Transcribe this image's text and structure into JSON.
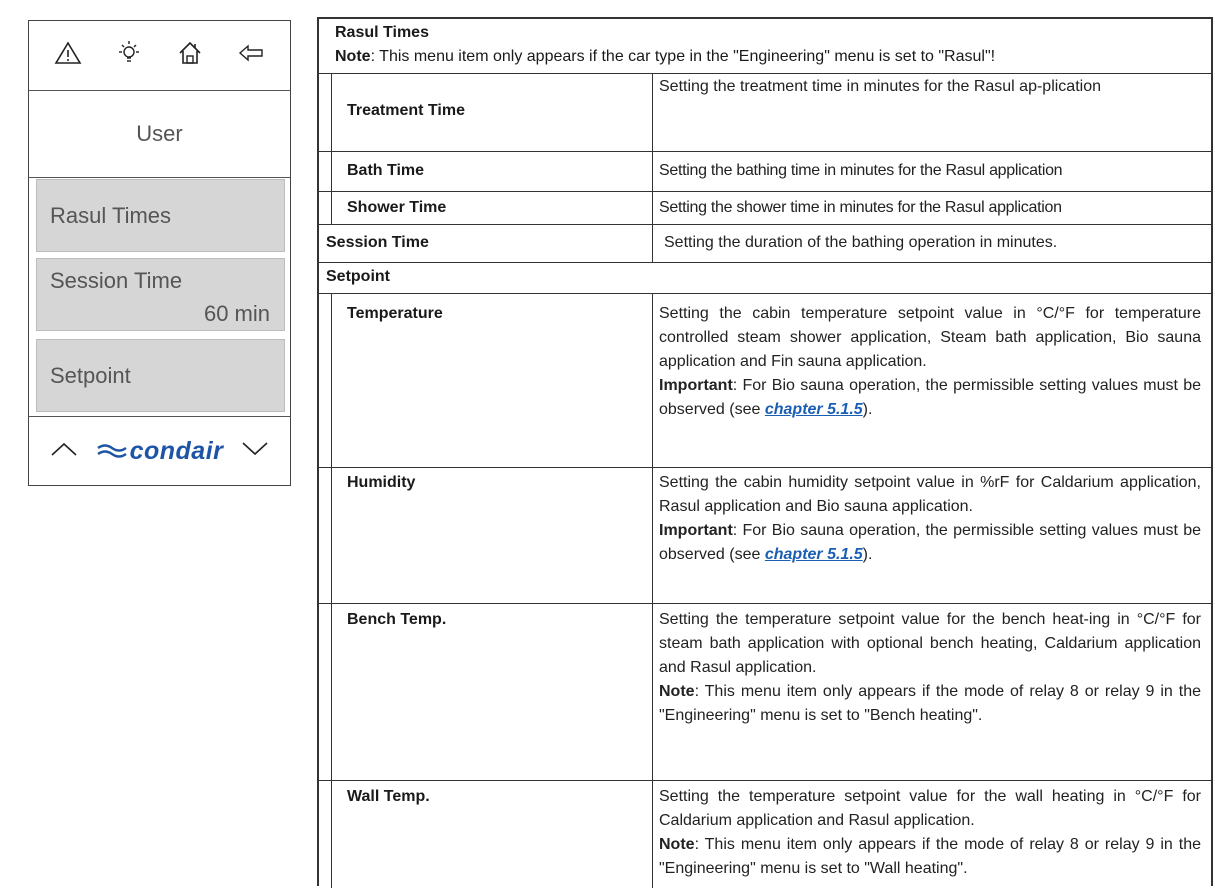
{
  "device": {
    "icons": [
      "warning-icon",
      "bulb-icon",
      "home-icon",
      "back-arrow-icon"
    ],
    "title": "User",
    "items": [
      {
        "label": "Rasul Times",
        "value": ""
      },
      {
        "label": "Session Time",
        "value": "60 min"
      },
      {
        "label": "Setpoint",
        "value": ""
      }
    ],
    "logo_text": "condair",
    "colors": {
      "logo": "#1e54a6",
      "item_bg": "#d6d6d6"
    }
  },
  "table": {
    "rasul": {
      "title": "Rasul Times",
      "note_label": "Note",
      "note_text": ": This menu item only appears if the car type in the \"Engineering\" menu is set to \"Rasul\"!",
      "rows": [
        {
          "name": "Treatment Time",
          "desc": "Setting the treatment time in minutes for the Rasul ap-plication"
        },
        {
          "name": "Bath Time",
          "desc": "Setting the bathing time in minutes for the Rasul application"
        },
        {
          "name": "Shower Time",
          "desc": "Setting the shower time in minutes for the Rasul application"
        }
      ]
    },
    "session": {
      "name": "Session Time",
      "desc": "Setting the duration of the bathing operation in minutes."
    },
    "setpoint": {
      "title": "Setpoint",
      "temperature": {
        "name": "Temperature",
        "desc": "Setting the cabin temperature setpoint value in °C/°F for temperature controlled steam shower application, Steam bath application, Bio sauna application and Fin sauna application.",
        "imp_label": "Important",
        "imp_text": ": For Bio sauna operation, the permissible setting values must be observed (see ",
        "link": "chapter 5.1.5",
        "imp_end": ")."
      },
      "humidity": {
        "name": "Humidity",
        "desc": "Setting the cabin humidity setpoint value in %rF for Caldarium application, Rasul application and Bio sauna application.",
        "imp_label": "Important",
        "imp_text": ": For Bio sauna operation, the permissible setting values must be observed (see ",
        "link": "chapter 5.1.5",
        "imp_end": ")."
      },
      "bench": {
        "name": "Bench Temp.",
        "desc": "Setting the temperature setpoint value for the bench heat-ing in °C/°F for steam bath application with optional bench heating, Caldarium application and Rasul application.",
        "note_label": "Note",
        "note_text": ": This menu item only appears if the mode of relay 8 or relay 9 in the \"Engineering\" menu is set to \"Bench heating\"."
      },
      "wall": {
        "name": "Wall Temp.",
        "desc": "Setting the temperature setpoint value for the wall heating in °C/°F for Caldarium application and Rasul application.",
        "note_label": "Note",
        "note_text": ": This menu item only appears if the mode of relay 8 or relay 9 in the \"Engineering\" menu is set to \"Wall heating\"."
      }
    }
  }
}
